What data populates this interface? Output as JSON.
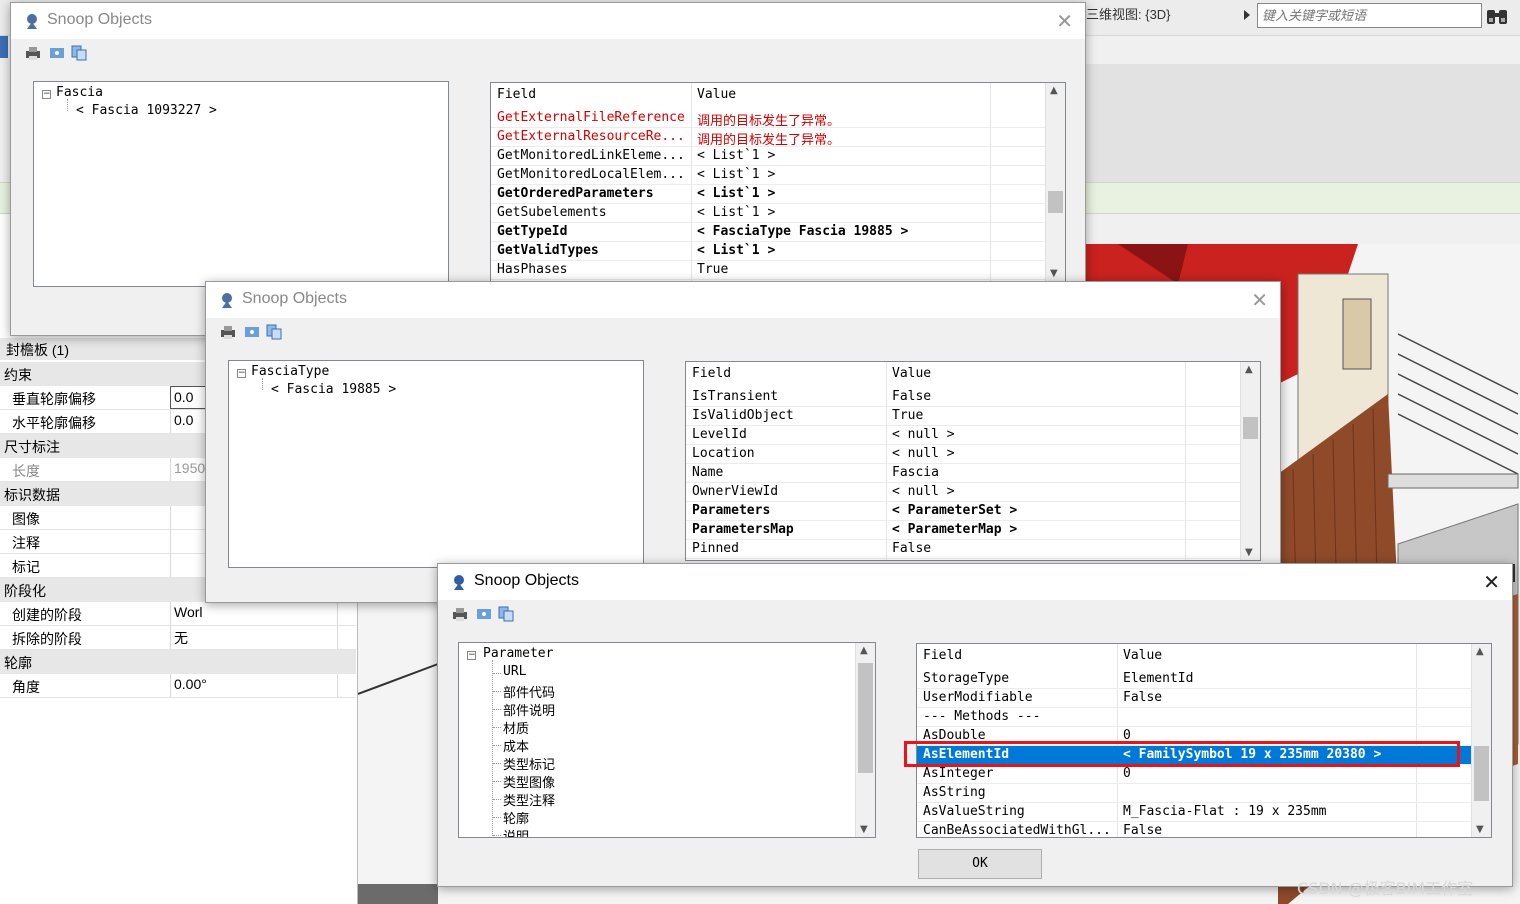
{
  "background": {
    "view_label": "三维视图: {3D}",
    "search_placeholder": "键入关键字或短语",
    "icons": [
      "triangle-right-icon",
      "binoculars-icon"
    ]
  },
  "properties": {
    "type_header": "封檐板 (1)",
    "groups": [
      {
        "name": "约束",
        "rows": [
          {
            "k": "垂直轮廓偏移",
            "v": "0.0"
          },
          {
            "k": "水平轮廓偏移",
            "v": "0.0"
          }
        ]
      },
      {
        "name": "尺寸标注",
        "rows": [
          {
            "k": "长度",
            "v": "1950"
          }
        ]
      },
      {
        "name": "标识数据",
        "rows": [
          {
            "k": "图像",
            "v": ""
          },
          {
            "k": "注释",
            "v": ""
          },
          {
            "k": "标记",
            "v": ""
          }
        ]
      },
      {
        "name": "阶段化",
        "rows": [
          {
            "k": "创建的阶段",
            "v": "Worl"
          },
          {
            "k": "拆除的阶段",
            "v": "无"
          }
        ]
      },
      {
        "name": "轮廓",
        "rows": [
          {
            "k": "角度",
            "v": "0.00°"
          }
        ]
      }
    ]
  },
  "dialog1": {
    "title": "Snoop Objects",
    "tree_root": "Fascia",
    "tree_child": "< Fascia  1093227 >",
    "grid_header": {
      "field": "Field",
      "value": "Value"
    },
    "rows": [
      {
        "field": "GetExternalFileReference",
        "value": "调用的目标发生了异常。",
        "style": "red"
      },
      {
        "field": "GetExternalResourceRe...",
        "value": "调用的目标发生了异常。",
        "style": "red"
      },
      {
        "field": "GetMonitoredLinkEleme...",
        "value": "< List`1 >",
        "style": ""
      },
      {
        "field": "GetMonitoredLocalElem...",
        "value": "< List`1 >",
        "style": ""
      },
      {
        "field": "GetOrderedParameters",
        "value": "< List`1 >",
        "style": "bold"
      },
      {
        "field": "GetSubelements",
        "value": "< List`1 >",
        "style": ""
      },
      {
        "field": "GetTypeId",
        "value": "< FasciaType  Fascia  19885 >",
        "style": "bold"
      },
      {
        "field": "GetValidTypes",
        "value": "< List`1 >",
        "style": "bold"
      },
      {
        "field": "HasPhases",
        "value": "True",
        "style": ""
      }
    ]
  },
  "dialog2": {
    "title": "Snoop Objects",
    "tree_root": "FasciaType",
    "tree_child": "< Fascia  19885 >",
    "grid_header": {
      "field": "Field",
      "value": "Value"
    },
    "rows": [
      {
        "field": "IsTransient",
        "value": "False",
        "style": ""
      },
      {
        "field": "IsValidObject",
        "value": "True",
        "style": ""
      },
      {
        "field": "LevelId",
        "value": "< null >",
        "style": ""
      },
      {
        "field": "Location",
        "value": "< null >",
        "style": ""
      },
      {
        "field": "Name",
        "value": "Fascia",
        "style": ""
      },
      {
        "field": "OwnerViewId",
        "value": "< null >",
        "style": ""
      },
      {
        "field": "Parameters",
        "value": "< ParameterSet >",
        "style": "bold"
      },
      {
        "field": "ParametersMap",
        "value": "< ParameterMap >",
        "style": "bold"
      },
      {
        "field": "Pinned",
        "value": "False",
        "style": ""
      }
    ]
  },
  "dialog3": {
    "title": "Snoop Objects",
    "tree_root": "Parameter",
    "tree_children": [
      "URL",
      "部件代码",
      "部件说明",
      "材质",
      "成本",
      "类型标记",
      "类型图像",
      "类型注释",
      "轮廓",
      "说明"
    ],
    "grid_header": {
      "field": "Field",
      "value": "Value"
    },
    "rows": [
      {
        "field": "StorageType",
        "value": "ElementId",
        "style": ""
      },
      {
        "field": "UserModifiable",
        "value": "False",
        "style": ""
      },
      {
        "field": "  --- Methods ---",
        "value": "",
        "style": "section"
      },
      {
        "field": "AsDouble",
        "value": "0",
        "style": ""
      },
      {
        "field": "AsElementId",
        "value": "< FamilySymbol  19 x 235mm  20380 >",
        "style": "selected"
      },
      {
        "field": "AsInteger",
        "value": "0",
        "style": ""
      },
      {
        "field": "AsString",
        "value": "",
        "style": ""
      },
      {
        "field": "AsValueString",
        "value": "M_Fascia-Flat : 19 x 235mm",
        "style": ""
      },
      {
        "field": "CanBeAssociatedWithGl...",
        "value": "False",
        "style": ""
      }
    ],
    "ok_label": "OK"
  },
  "watermark": "CSDN @极客BIM工作室",
  "colors": {
    "selection": "#0078d7",
    "highlight_box": "#e8141a",
    "arrow": "#e8141a",
    "error_text": "#d40000"
  }
}
